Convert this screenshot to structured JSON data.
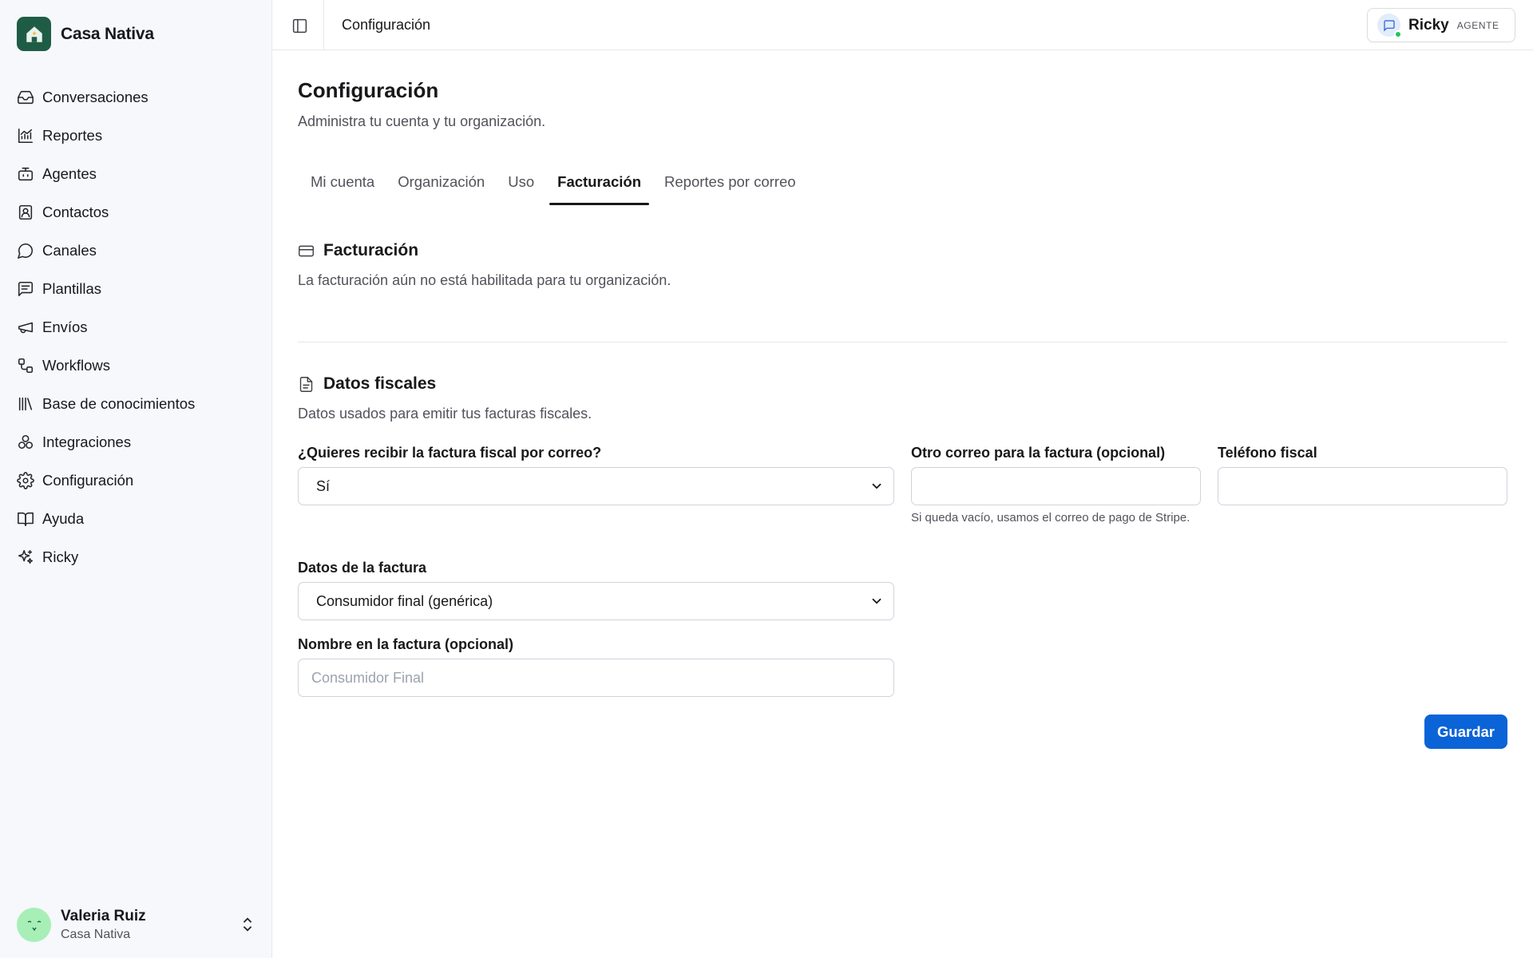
{
  "brand": {
    "name": "Casa Nativa"
  },
  "sidebar": {
    "items": [
      {
        "label": "Conversaciones",
        "icon": "inbox-icon"
      },
      {
        "label": "Reportes",
        "icon": "chart-icon"
      },
      {
        "label": "Agentes",
        "icon": "bot-icon"
      },
      {
        "label": "Contactos",
        "icon": "contact-icon"
      },
      {
        "label": "Canales",
        "icon": "chat-bubble-icon"
      },
      {
        "label": "Plantillas",
        "icon": "message-square-icon"
      },
      {
        "label": "Envíos",
        "icon": "megaphone-icon"
      },
      {
        "label": "Workflows",
        "icon": "workflow-icon"
      },
      {
        "label": "Base de conocimientos",
        "icon": "library-icon"
      },
      {
        "label": "Integraciones",
        "icon": "integrations-icon"
      },
      {
        "label": "Configuración",
        "icon": "gear-icon"
      },
      {
        "label": "Ayuda",
        "icon": "book-icon"
      },
      {
        "label": "Ricky",
        "icon": "sparkles-icon"
      }
    ]
  },
  "user": {
    "name": "Valeria Ruiz",
    "org": "Casa Nativa",
    "avatar_glyph": "˘ ˘\nᵥ"
  },
  "topbar": {
    "breadcrumb": "Configuración"
  },
  "agent_chip": {
    "name": "Ricky",
    "role": "AGENTE"
  },
  "page": {
    "title": "Configuración",
    "subtitle": "Administra tu cuenta y tu organización."
  },
  "tabs": [
    {
      "label": "Mi cuenta",
      "active": false
    },
    {
      "label": "Organización",
      "active": false
    },
    {
      "label": "Uso",
      "active": false
    },
    {
      "label": "Facturación",
      "active": true
    },
    {
      "label": "Reportes por correo",
      "active": false
    }
  ],
  "billing": {
    "title": "Facturación",
    "description": "La facturación aún no está habilitada para tu organización."
  },
  "fiscal": {
    "title": "Datos fiscales",
    "description": "Datos usados para emitir tus facturas fiscales.",
    "receive_by_email": {
      "label": "¿Quieres recibir la factura fiscal por correo?",
      "value": "Sí"
    },
    "other_email": {
      "label": "Otro correo para la factura (opcional)",
      "value": "",
      "hint": "Si queda vacío, usamos el correo de pago de Stripe."
    },
    "phone": {
      "label": "Teléfono fiscal",
      "value": ""
    },
    "invoice_data": {
      "label": "Datos de la factura",
      "value": "Consumidor final (genérica)"
    },
    "invoice_name": {
      "label": "Nombre en la factura (opcional)",
      "placeholder": "Consumidor Final",
      "value": ""
    },
    "save_label": "Guardar"
  },
  "colors": {
    "accent": "#0b63d8",
    "brand": "#1f5c46",
    "sidebar_bg": "#f6f8fb",
    "online": "#22c55e"
  }
}
